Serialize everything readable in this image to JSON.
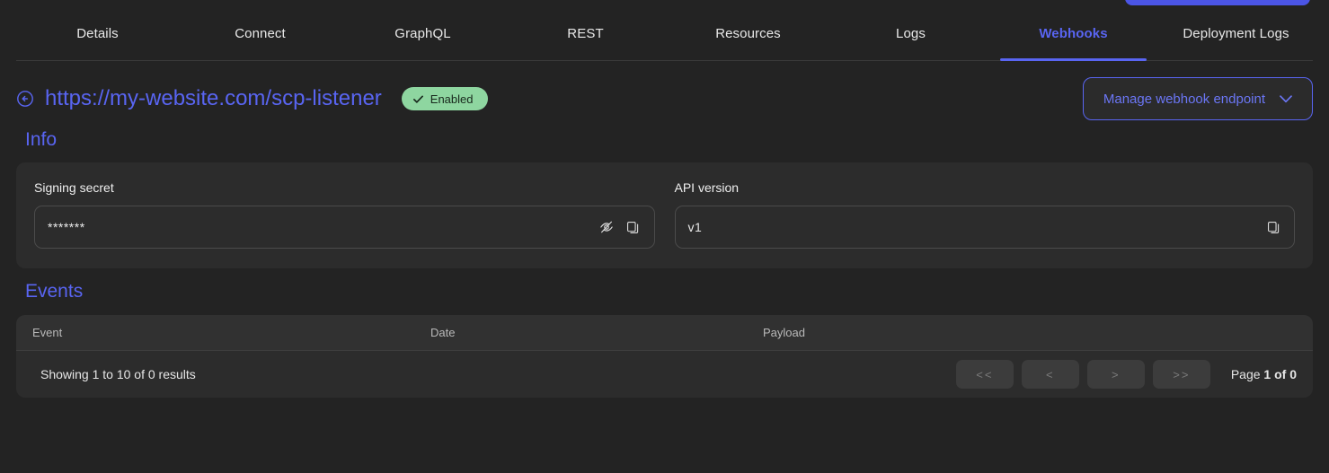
{
  "top_button": {
    "name": "primary-action-button-cut-off",
    "color": "#4b55e6"
  },
  "tabs": [
    {
      "label": "Details",
      "active": false
    },
    {
      "label": "Connect",
      "active": false
    },
    {
      "label": "GraphQL",
      "active": false
    },
    {
      "label": "REST",
      "active": false
    },
    {
      "label": "Resources",
      "active": false
    },
    {
      "label": "Logs",
      "active": false
    },
    {
      "label": "Webhooks",
      "active": true
    },
    {
      "label": "Deployment Logs",
      "active": false
    }
  ],
  "header": {
    "back_icon": "circle-arrow-left-icon",
    "endpoint_url": "https://my-website.com/scp-listener",
    "status": {
      "label": "Enabled",
      "icon": "check-icon",
      "bg": "#8ed6a0",
      "fg": "#18281c"
    },
    "manage_button": {
      "label": "Manage webhook endpoint",
      "icon": "chevron-down-icon"
    }
  },
  "info": {
    "title": "Info",
    "signing_secret": {
      "label": "Signing secret",
      "value": "*******",
      "toggle_icon": "eye-off-icon",
      "copy_icon": "copy-icon"
    },
    "api_version": {
      "label": "API version",
      "value": "v1",
      "copy_icon": "copy-icon"
    }
  },
  "events": {
    "title": "Events",
    "columns": [
      "Event",
      "Date",
      "Payload"
    ],
    "rows": [],
    "footer": {
      "results_text": "Showing 1 to 10 of 0 results",
      "pager": [
        {
          "label": "<<",
          "name": "first-page-button"
        },
        {
          "label": "<",
          "name": "previous-page-button"
        },
        {
          "label": ">",
          "name": "next-page-button"
        },
        {
          "label": ">>",
          "name": "last-page-button"
        }
      ],
      "page_prefix": "Page ",
      "page_value": "1 of 0"
    }
  },
  "colors": {
    "page_bg": "#232323",
    "card_bg": "#2c2c2c",
    "accent": "#5965f2",
    "status_green": "#8ed6a0"
  }
}
